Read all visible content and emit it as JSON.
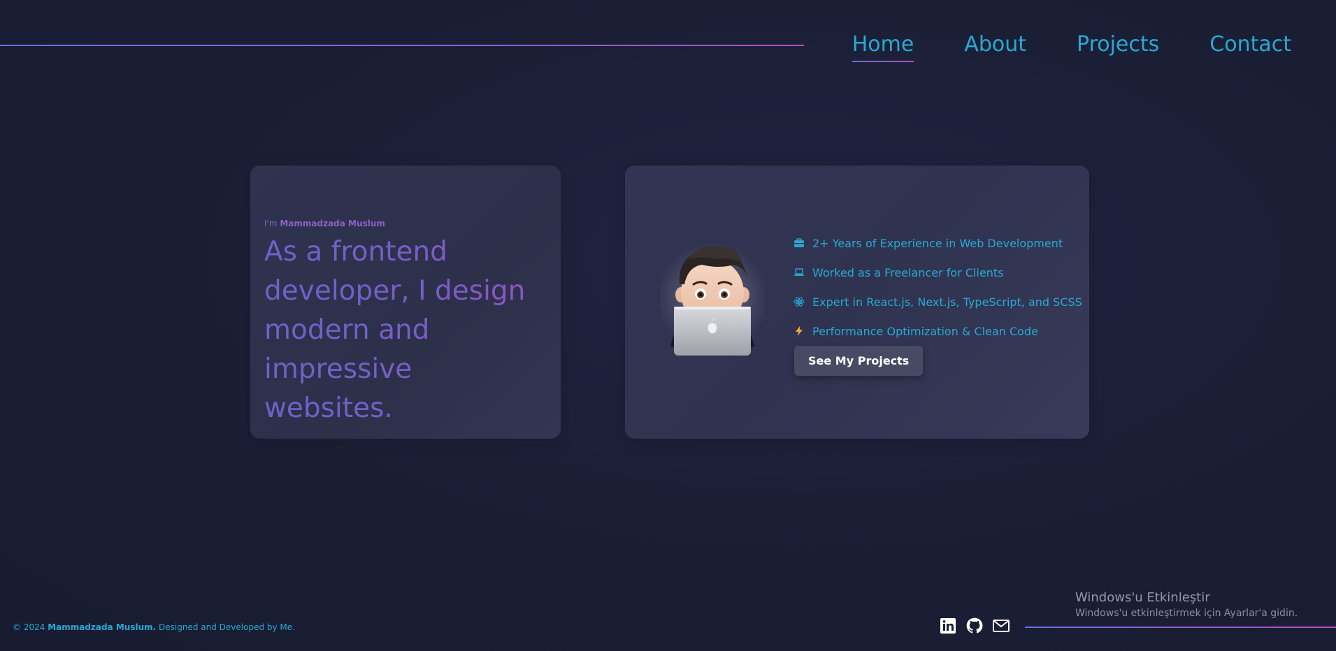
{
  "nav": {
    "items": [
      {
        "label": "Home",
        "active": true
      },
      {
        "label": "About",
        "active": false
      },
      {
        "label": "Projects",
        "active": false
      },
      {
        "label": "Contact",
        "active": false
      }
    ]
  },
  "hero": {
    "intro_prefix": "I'm",
    "intro_name": "Mammadzada Muslum",
    "headline": "As a frontend developer, I design modern and impressive websites."
  },
  "features": {
    "items": [
      {
        "icon": "briefcase-icon",
        "label": "2+ Years of Experience in Web Development"
      },
      {
        "icon": "laptop-icon",
        "label": "Worked as a Freelancer for Clients"
      },
      {
        "icon": "react-icon",
        "label": "Expert in React.js, Next.js, TypeScript, and SCSS"
      },
      {
        "icon": "bolt-icon",
        "label": "Performance Optimization & Clean Code"
      }
    ],
    "cta_label": "See My Projects"
  },
  "footer": {
    "copyright_prefix": "© 2024",
    "copyright_name": "Mammadzada Muslum.",
    "copyright_suffix": "Designed and Developed by Me.",
    "socials": [
      "linkedin-icon",
      "github-icon",
      "mail-icon"
    ]
  },
  "watermark": {
    "title": "Windows'u Etkinleştir",
    "subtitle": "Windows'u etkinleştirmek için Ayarlar'a gidin."
  },
  "colors": {
    "accent": "#2aa8d4",
    "gradient_start": "#6b6fe0",
    "gradient_end": "#b44fc7",
    "bolt": "#f0a830",
    "background": "#1b1f36"
  }
}
